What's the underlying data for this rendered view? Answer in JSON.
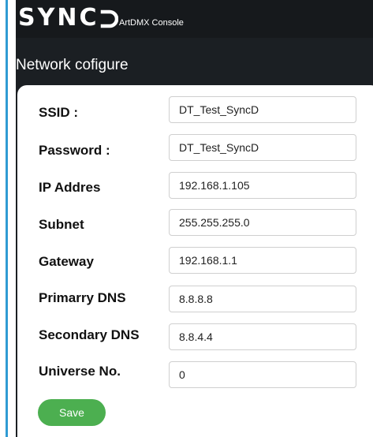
{
  "header": {
    "logo_text": "SYNCD",
    "logo_visible_letters": "SYNC",
    "subtitle": "ArtDMX Console"
  },
  "page": {
    "title": "Network cofigure"
  },
  "form": {
    "fields": [
      {
        "label": "SSID :",
        "value": "DT_Test_SyncD"
      },
      {
        "label": "Password :",
        "value": "DT_Test_SyncD"
      },
      {
        "label": "IP Addres",
        "value": "192.168.1.105"
      },
      {
        "label": "Subnet",
        "value": "255.255.255.0"
      },
      {
        "label": "Gateway",
        "value": "192.168.1.1"
      },
      {
        "label": "Primarry DNS",
        "value": "8.8.8.8"
      },
      {
        "label": "Secondary DNS",
        "value": "8.8.4.4"
      },
      {
        "label": "Universe No.",
        "value": "0"
      }
    ],
    "save_label": "Save"
  },
  "colors": {
    "accent_bar": "#2f9bd3",
    "app_background": "#1b1f23",
    "save_button": "#4caf50"
  }
}
